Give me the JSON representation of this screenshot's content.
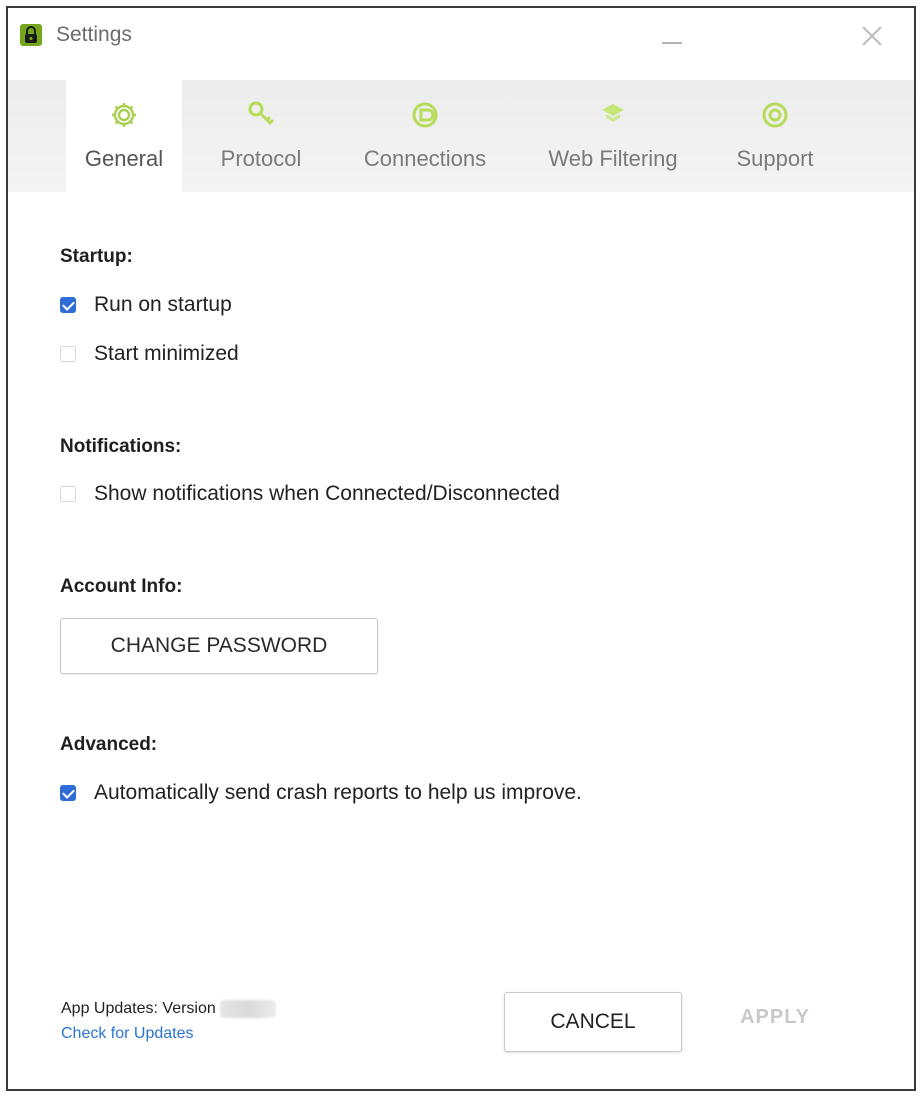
{
  "window": {
    "title": "Settings",
    "app_icon": "lock-icon"
  },
  "tabs": [
    {
      "label": "General",
      "icon": "gear-icon",
      "active": true
    },
    {
      "label": "Protocol",
      "icon": "key-icon",
      "active": false
    },
    {
      "label": "Connections",
      "icon": "connections-icon",
      "active": false
    },
    {
      "label": "Web Filtering",
      "icon": "filter-icon",
      "active": false
    },
    {
      "label": "Support",
      "icon": "support-icon",
      "active": false
    }
  ],
  "startup": {
    "title": "Startup:",
    "run_on_startup": {
      "label": "Run on startup",
      "checked": true
    },
    "start_minimized": {
      "label": "Start minimized",
      "checked": false
    }
  },
  "notifications": {
    "title": "Notifications:",
    "show_notifications": {
      "label": "Show notifications when Connected/Disconnected",
      "checked": false
    }
  },
  "account": {
    "title": "Account Info:",
    "change_password_label": "CHANGE PASSWORD"
  },
  "advanced": {
    "title": "Advanced:",
    "crash_reports": {
      "label": "Automatically send crash reports to help us improve.",
      "checked": true
    }
  },
  "footer": {
    "app_updates_label": "App Updates: Version",
    "check_updates_label": "Check for Updates",
    "cancel_label": "CANCEL",
    "apply_label": "APPLY"
  },
  "colors": {
    "accent_green": "#8cc63f",
    "checkbox_blue": "#2f6cd6",
    "link_blue": "#2a73d6"
  }
}
